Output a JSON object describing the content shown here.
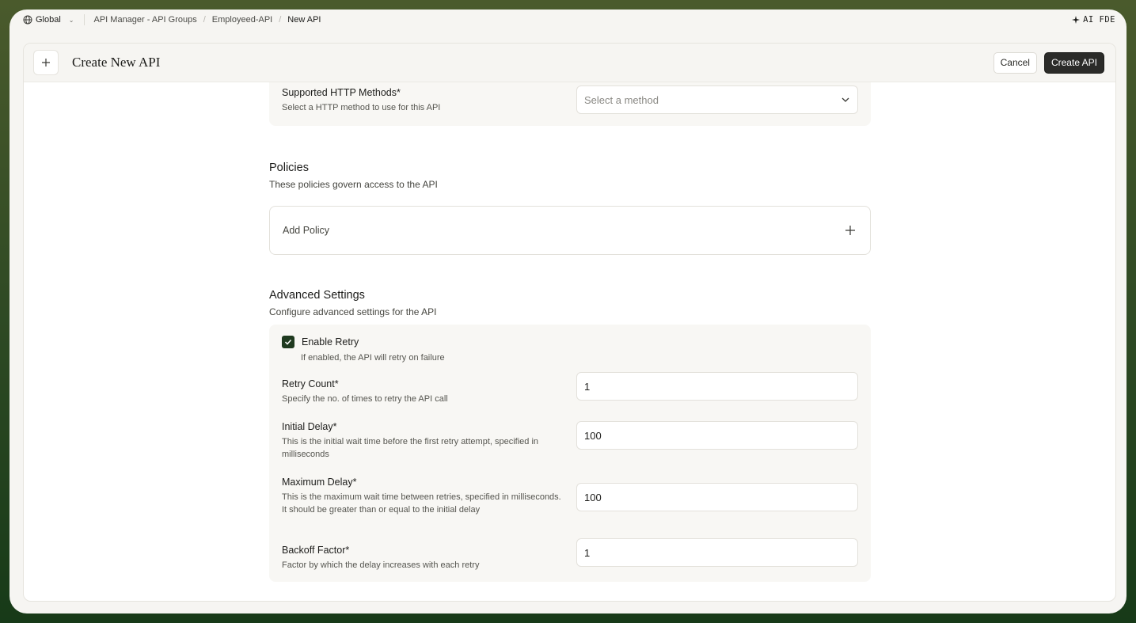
{
  "topbar": {
    "scope": "Global",
    "breadcrumbs": [
      "API Manager - API Groups",
      "Employeed-API",
      "New API"
    ],
    "right_label": "AI FDE"
  },
  "header": {
    "title": "Create New API",
    "cancel_label": "Cancel",
    "create_label": "Create API"
  },
  "http_methods": {
    "label": "Supported HTTP Methods*",
    "description": "Select a HTTP method to use for this API",
    "placeholder": "Select a method"
  },
  "policies": {
    "title": "Policies",
    "description": "These policies govern access to the API",
    "add_label": "Add Policy"
  },
  "advanced": {
    "title": "Advanced Settings",
    "description": "Configure advanced settings for the API",
    "enable_retry": {
      "label": "Enable Retry",
      "description": "If enabled, the API will retry on failure",
      "checked": true
    },
    "retry_count": {
      "label": "Retry Count*",
      "description": "Specify the no. of times to retry the API call",
      "value": "1"
    },
    "initial_delay": {
      "label": "Initial Delay*",
      "description": "This is the initial wait time before the first retry attempt, specified in milliseconds",
      "value": "100"
    },
    "maximum_delay": {
      "label": "Maximum Delay*",
      "description": "This is the maximum wait time between retries, specified in milliseconds. It should be greater than or equal to the initial delay",
      "value": "100"
    },
    "backoff_factor": {
      "label": "Backoff Factor*",
      "description": "Factor by which the delay increases with each retry",
      "value": "1"
    }
  },
  "colors": {
    "primary_button": "#2b2b29",
    "checkbox": "#1f3a1f",
    "background": "#f6f5f2"
  }
}
